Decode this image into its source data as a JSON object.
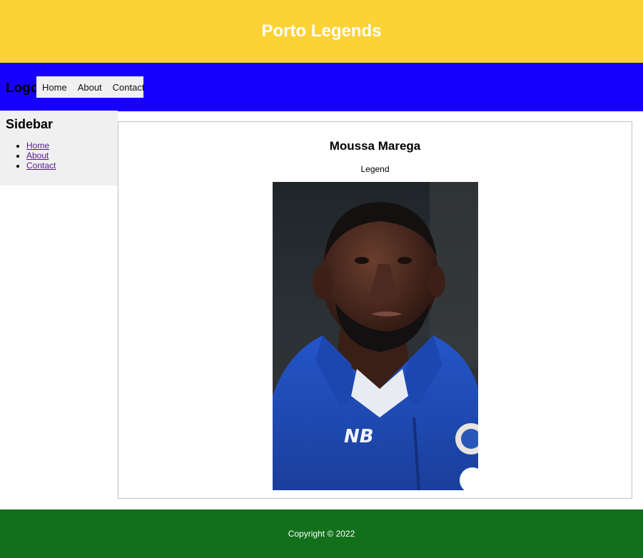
{
  "header": {
    "title": "Porto Legends"
  },
  "navbar": {
    "logo": "Logo",
    "links": [
      {
        "label": "Home"
      },
      {
        "label": "About"
      },
      {
        "label": "Contact"
      }
    ]
  },
  "sidebar": {
    "title": "Sidebar",
    "links": [
      {
        "label": "Home"
      },
      {
        "label": "About"
      },
      {
        "label": "Contact"
      }
    ]
  },
  "main": {
    "player_name": "Moussa Marega",
    "player_status": "Legend"
  },
  "footer": {
    "copyright": "Copyright © 2022"
  },
  "colors": {
    "header_bg": "#fdd235",
    "navbar_bg": "#1800ff",
    "footer_bg": "#12701b",
    "sidebar_bg": "#f0f0f0",
    "link_visited": "#551a8b"
  }
}
